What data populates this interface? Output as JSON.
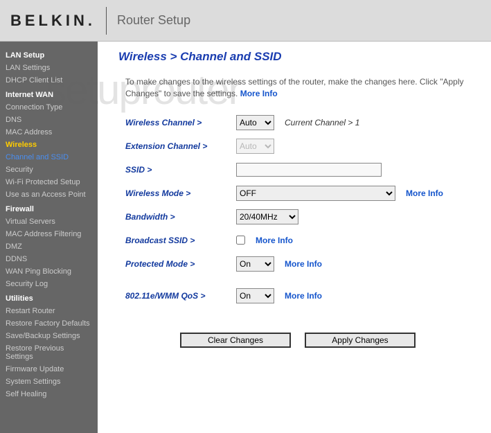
{
  "header": {
    "logo": "BELKIN",
    "logo_dot": ".",
    "title": "Router Setup"
  },
  "watermark": "setuprouter",
  "sidebar": {
    "sections": [
      {
        "title": "LAN Setup",
        "items": [
          "LAN Settings",
          "DHCP Client List"
        ]
      },
      {
        "title": "Internet WAN",
        "items": [
          "Connection Type",
          "DNS",
          "MAC Address"
        ]
      },
      {
        "title": "Wireless",
        "active_section": true,
        "items": [
          "Channel and SSID",
          "Security",
          "Wi-Fi Protected Setup",
          "Use as an Access Point"
        ],
        "active_index": 0
      },
      {
        "title": "Firewall",
        "items": [
          "Virtual Servers",
          "MAC Address Filtering",
          "DMZ",
          "DDNS",
          "WAN Ping Blocking",
          "Security Log"
        ]
      },
      {
        "title": "Utilities",
        "items": [
          "Restart Router",
          "Restore Factory Defaults",
          "Save/Backup Settings",
          "Restore Previous Settings",
          "Firmware Update",
          "System Settings",
          "Self Healing"
        ]
      }
    ]
  },
  "breadcrumb": "Wireless > Channel and SSID",
  "description": {
    "text": "To make changes to the wireless settings of the router, make the changes here. Click \"Apply Changes\" to save the settings. ",
    "more": "More Info"
  },
  "fields": {
    "wireless_channel": {
      "label": "Wireless Channel >",
      "value": "Auto",
      "hint": "Current Channel > 1"
    },
    "extension_channel": {
      "label": "Extension Channel >",
      "value": "Auto"
    },
    "ssid": {
      "label": "SSID >",
      "value": ""
    },
    "wireless_mode": {
      "label": "Wireless Mode >",
      "value": "OFF",
      "more": "More Info"
    },
    "bandwidth": {
      "label": "Bandwidth >",
      "value": "20/40MHz"
    },
    "broadcast_ssid": {
      "label": "Broadcast SSID >",
      "checked": false,
      "more": "More Info"
    },
    "protected_mode": {
      "label": "Protected Mode >",
      "value": "On",
      "more": "More Info"
    },
    "wmm_qos": {
      "label": "802.11e/WMM QoS >",
      "value": "On",
      "more": "More Info"
    }
  },
  "buttons": {
    "clear": "Clear Changes",
    "apply": "Apply Changes"
  }
}
